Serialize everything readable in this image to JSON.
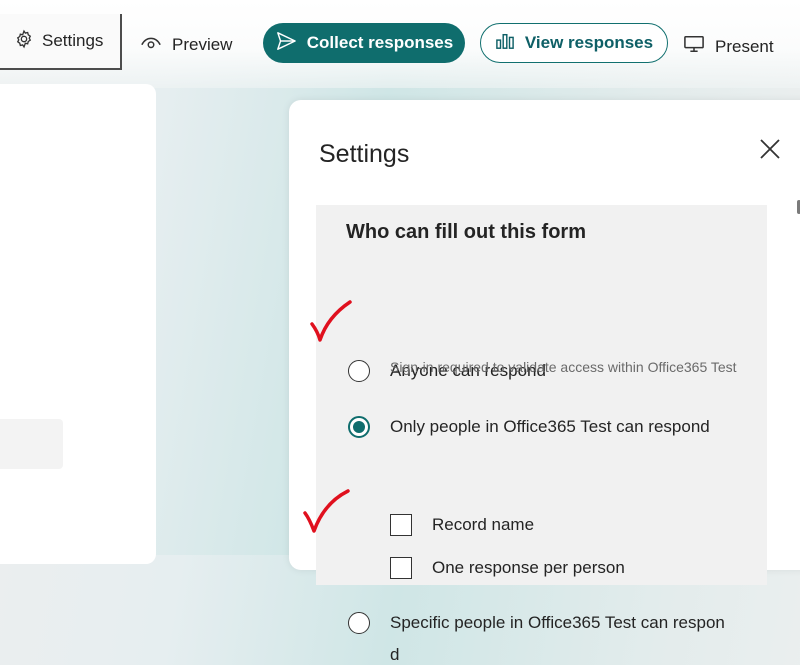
{
  "toolbar": {
    "settings_label": "Settings",
    "preview_label": "Preview",
    "collect_label": "Collect responses",
    "view_label": "View responses",
    "present_label": "Present"
  },
  "settings_panel": {
    "title": "Settings",
    "section_heading": "Who can fill out this form",
    "options": [
      {
        "label": "Anyone can respond",
        "checked": false
      },
      {
        "label": "Only people in Office365 Test can respond",
        "checked": true
      },
      {
        "label": "Specific people in Office365 Test can respon",
        "checked": false
      }
    ],
    "option_3_wrap": "d",
    "hint": "Sign-in required to validate access within Office365 Test",
    "checkboxes": [
      {
        "label": "Record name",
        "checked": false
      },
      {
        "label": "One response per person",
        "checked": false
      }
    ]
  },
  "colors": {
    "accent": "#0f6d6d",
    "annotation": "#e0101e"
  },
  "icons": [
    "gear-icon",
    "eye-icon",
    "send-icon",
    "bar-chart-icon",
    "monitor-icon",
    "close-icon"
  ]
}
